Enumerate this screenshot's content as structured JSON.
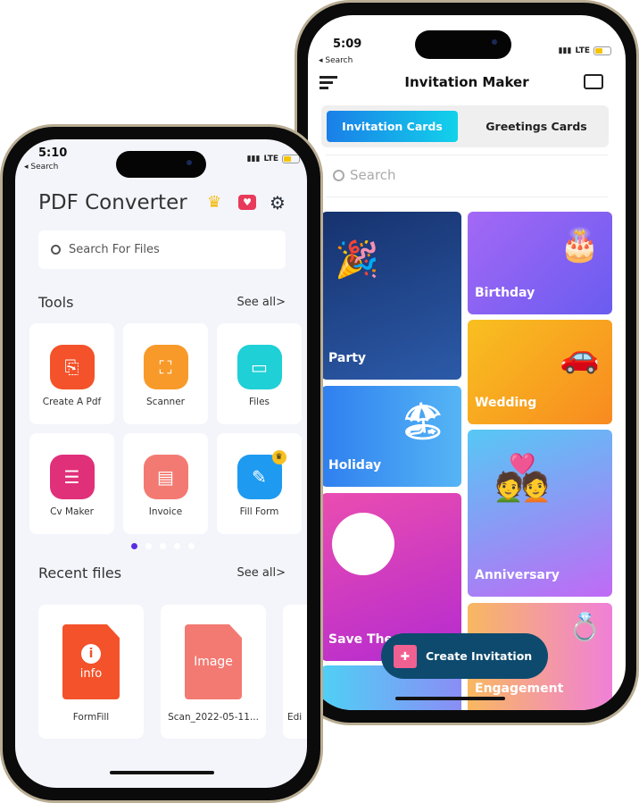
{
  "right_phone": {
    "status": {
      "time": "5:09",
      "back": "◂ Search",
      "network": "LTE",
      "battery_level": 0.5
    },
    "header": {
      "title": "Invitation Maker",
      "menu_icon": "hamburger-icon",
      "folder_icon": "folder-icon"
    },
    "tabs": [
      {
        "label": "Invitation Cards",
        "active": true
      },
      {
        "label": "Greetings Cards",
        "active": false
      }
    ],
    "search": {
      "placeholder": "Search"
    },
    "cards": [
      {
        "label": "Party",
        "color": "#1f3f85"
      },
      {
        "label": "Holiday",
        "color": "#3f8ef0"
      },
      {
        "label": "Save The Date",
        "color": "#d63fc2"
      },
      {
        "label": "",
        "color": "#4fc8f0"
      },
      {
        "label": "Birthday",
        "color": "#8a60f5"
      },
      {
        "label": "Wedding",
        "color": "#f7a020"
      },
      {
        "label": "Anniversary",
        "color": "#6a8ef8"
      },
      {
        "label": "Engagement",
        "color": "#f6a0a0"
      }
    ],
    "fab": {
      "label": "Create Invitation",
      "color": "#0d4a6e"
    }
  },
  "left_phone": {
    "status": {
      "time": "5:10",
      "back": "◂ Search",
      "network": "LTE",
      "battery_level": 0.5
    },
    "header": {
      "title": "PDF Converter",
      "icons": [
        "crown-icon",
        "heart-chat-icon",
        "gear-icon"
      ]
    },
    "search": {
      "placeholder": "Search For Files"
    },
    "tools_section": {
      "title": "Tools",
      "see_all": "See all>"
    },
    "tools": [
      {
        "label": "Create A Pdf",
        "color": "#f4522a",
        "icon": "pdf-add-icon"
      },
      {
        "label": "Scanner",
        "color": "#f89a2a",
        "icon": "scan-icon"
      },
      {
        "label": "Files",
        "color": "#1fd0d6",
        "icon": "folder-icon"
      },
      {
        "label": "Cv Maker",
        "color": "#e0307a",
        "icon": "document-icon"
      },
      {
        "label": "Invoice",
        "color": "#f37a72",
        "icon": "invoice-icon"
      },
      {
        "label": "Fill Form",
        "color": "#1e9af0",
        "icon": "form-edit-icon",
        "premium": true
      }
    ],
    "pager": {
      "pages": 5,
      "active": 1,
      "active_color": "#5a2fe0"
    },
    "recent_section": {
      "title": "Recent files",
      "see_all": "See all>"
    },
    "recent_files": [
      {
        "name": "FormFill",
        "thumb_text": "info",
        "color": "#f4522a"
      },
      {
        "name": "Scan_2022-05-11...",
        "thumb_text": "Image",
        "color": "#f37a72"
      },
      {
        "name": "Edi"
      }
    ]
  }
}
